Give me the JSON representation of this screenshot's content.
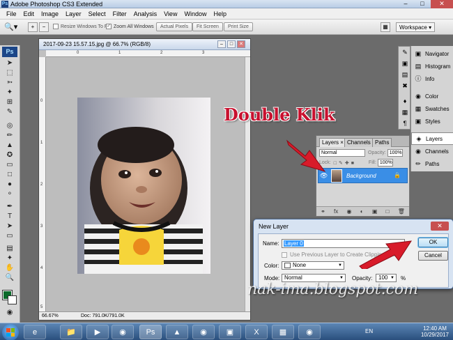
{
  "app": {
    "title": "Adobe Photoshop CS3 Extended"
  },
  "menu": [
    "File",
    "Edit",
    "Image",
    "Layer",
    "Select",
    "Filter",
    "Analysis",
    "View",
    "Window",
    "Help"
  ],
  "options": {
    "resize_label": "Resize Windows To Fit",
    "zoom_all_label": "Zoom All Windows",
    "actual_pixels": "Actual Pixels",
    "fit_screen": "Fit Screen",
    "print_size": "Print Size",
    "workspace": "Workspace ▾"
  },
  "tools_logo": "Ps",
  "document": {
    "title": "2017-09-23 15.57.15.jpg @ 66.7% (RGB/8)",
    "zoom": "66.67%",
    "doc_info": "Doc: 791.0K/791.0K",
    "ruler_marks": [
      "0",
      "1",
      "2",
      "3",
      "4",
      "5"
    ]
  },
  "panels": {
    "items": [
      "Navigator",
      "Histogram",
      "Info",
      "Color",
      "Swatches",
      "Styles",
      "Layers",
      "Channels",
      "Paths"
    ]
  },
  "layers_panel": {
    "tabs": [
      "Layers ×",
      "Channels",
      "Paths"
    ],
    "blend_mode": "Normal",
    "opacity_label": "Opacity:",
    "opacity_value": "100%",
    "lock_label": "Lock:",
    "fill_label": "Fill:",
    "fill_value": "100%",
    "layer_name": "Background"
  },
  "dialog": {
    "title": "New Layer",
    "name_label": "Name:",
    "name_value": "Layer 0",
    "clipping_label": "Use Previous Layer to Create Clipping Mask",
    "color_label": "Color:",
    "color_value": "None",
    "mode_label": "Mode:",
    "mode_value": "Normal",
    "opacity_label": "Opacity:",
    "opacity_value": "100",
    "percent": "%",
    "ok": "OK",
    "cancel": "Cancel"
  },
  "annotation": {
    "text": "Double Klik",
    "color": "#c8102e"
  },
  "watermark": "nak-ima.blogspot.com",
  "taskbar": {
    "lang": "EN",
    "time": "12:40 AM",
    "date": "10/29/2017"
  }
}
